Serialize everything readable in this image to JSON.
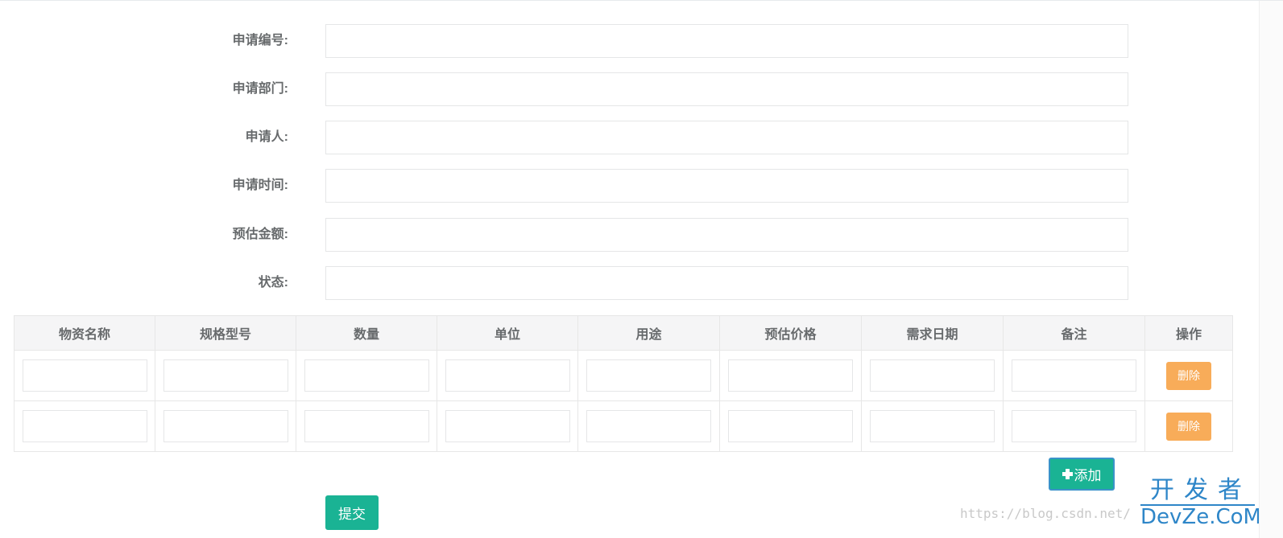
{
  "form": {
    "fields": [
      {
        "label": "申请编号:",
        "value": ""
      },
      {
        "label": "申请部门:",
        "value": ""
      },
      {
        "label": "申请人:",
        "value": ""
      },
      {
        "label": "申请时间:",
        "value": ""
      },
      {
        "label": "预估金额:",
        "value": ""
      },
      {
        "label": "状态:",
        "value": ""
      }
    ]
  },
  "table": {
    "columns": [
      "物资名称",
      "规格型号",
      "数量",
      "单位",
      "用途",
      "预估价格",
      "需求日期",
      "备注",
      "操作"
    ],
    "delete_label": "删除",
    "rows": [
      [
        "",
        "",
        "",
        "",
        "",
        "",
        "",
        ""
      ],
      [
        "",
        "",
        "",
        "",
        "",
        "",
        "",
        ""
      ]
    ]
  },
  "actions": {
    "add_label": "添加",
    "submit_label": "提交"
  },
  "watermark": {
    "url": "https://blog.csdn.net/",
    "logo_zh": "开发者",
    "logo_en": "DevZe.CoM"
  },
  "colors": {
    "primary": "#1ab394",
    "warning": "#f8ac59",
    "label_text": "#676a6c",
    "header_bg": "#f5f5f6",
    "logo_blue": "#2e86c8"
  }
}
